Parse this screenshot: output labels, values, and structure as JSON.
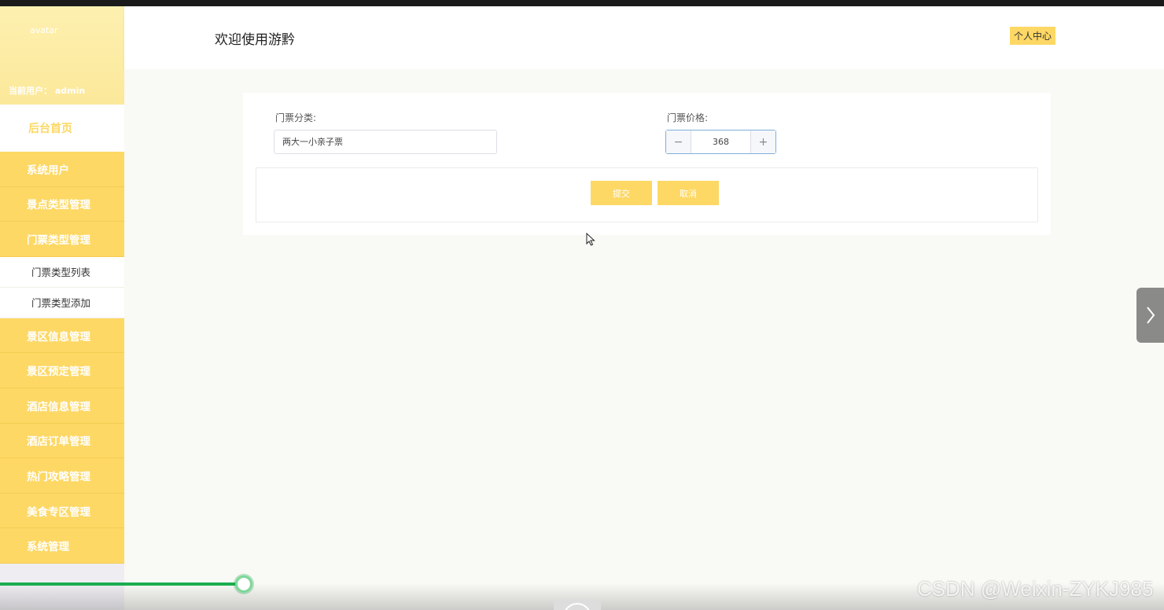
{
  "sidebar": {
    "avatar_alt": "avatar",
    "current_user": "当前用户：  admin",
    "home": "后台首页",
    "menu": [
      "系统用户",
      "景点类型管理",
      "门票类型管理",
      "景区信息管理",
      "景区预定管理",
      "酒店信息管理",
      "酒店订单管理",
      "热门攻略管理",
      "美食专区管理",
      "系统管理"
    ],
    "submenu": [
      "门票类型列表",
      "门票类型添加"
    ]
  },
  "header": {
    "welcome": "欢迎使用游黔",
    "personal_center": "个人中心"
  },
  "form": {
    "category_label": "门票分类:",
    "category_value": "两大一小亲子票",
    "price_label": "门票价格:",
    "price_value": "368",
    "minus": "−",
    "plus": "+",
    "submit": "提交",
    "cancel": "取消"
  },
  "player": {
    "progress": 0.21
  },
  "watermark": "CSDN @Weixin-ZYKJ985",
  "colors": {
    "accent": "#fdd865",
    "progress": "#1aad4f"
  }
}
